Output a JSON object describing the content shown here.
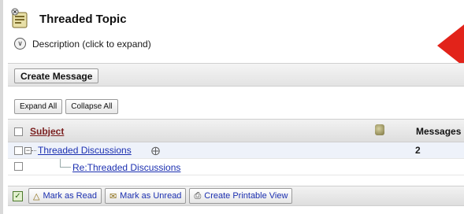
{
  "header": {
    "title": "Threaded Topic",
    "description_toggle_label": "Description (click to expand)",
    "topic_icon": "threaded-topic-icon",
    "expand_icon": "chevron-circle-down-icon"
  },
  "toolbar": {
    "create_message_label": "Create Message",
    "expand_all_label": "Expand All",
    "collapse_all_label": "Collapse All"
  },
  "table": {
    "columns": {
      "subject": "Subject",
      "attachment_icon": "attachment-column-icon",
      "messages": "Messages"
    },
    "rows": [
      {
        "subject": "Threaded Discussions",
        "messages": "2",
        "level": 0,
        "expanded": true
      },
      {
        "subject": "Re:Threaded Discussions",
        "messages": "",
        "level": 1
      }
    ]
  },
  "actions": {
    "mark_as_read_label": "Mark as Read",
    "mark_as_unread_label": "Mark as Unread",
    "create_printable_view_label": "Create Printable View"
  },
  "colors": {
    "link": "#1b2fb0",
    "subject_header": "#7a1f1f",
    "accent_triangle": "#e2231a"
  }
}
